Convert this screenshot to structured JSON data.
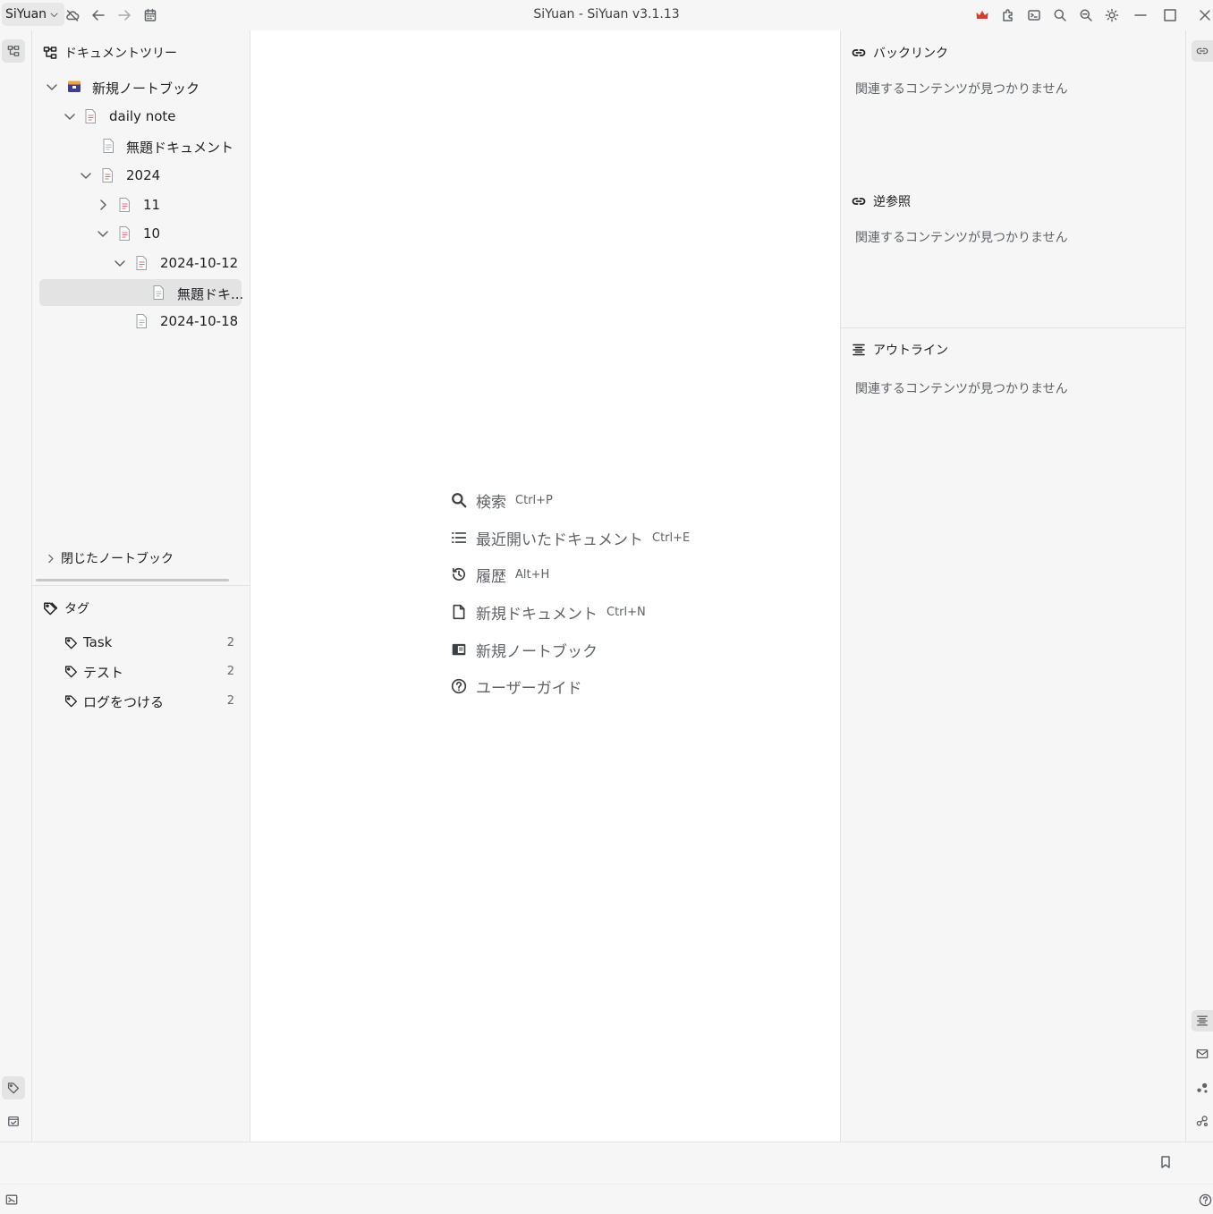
{
  "window": {
    "title": "SiYuan - SiYuan v3.1.13",
    "workspace_label": "SiYuan"
  },
  "toolbar": {
    "left_icons": [
      "sync-cloud-icon",
      "back-arrow-icon",
      "forward-arrow-icon",
      "calendar-icon"
    ],
    "right_icons": [
      "crown-icon",
      "plugin-icon",
      "command-icon",
      "search-icon",
      "zoom-icon",
      "theme-sun-icon",
      "minimize-icon",
      "maximize-icon",
      "close-icon"
    ],
    "accent_color": "#d23f31"
  },
  "left_dock": {
    "icons": [
      "file-tree-icon",
      "tag-icon",
      "calendar-check-icon"
    ]
  },
  "file_tree": {
    "title": "ドキュメントツリー",
    "items": [
      {
        "label": "新規ノートブック",
        "kind": "notebook",
        "expanded": true
      },
      {
        "label": "daily note",
        "kind": "doc",
        "expanded": true
      },
      {
        "label": "無題ドキュメント",
        "kind": "doc"
      },
      {
        "label": "2024",
        "kind": "doc",
        "expanded": true
      },
      {
        "label": "11",
        "kind": "doc",
        "expanded": false
      },
      {
        "label": "10",
        "kind": "doc",
        "expanded": true
      },
      {
        "label": "2024-10-12",
        "kind": "doc",
        "expanded": true
      },
      {
        "label": "無題ドキ...",
        "kind": "doc",
        "selected": true
      },
      {
        "label": "2024-10-18",
        "kind": "doc"
      }
    ],
    "closed_notebooks_label": "閉じたノートブック"
  },
  "tags": {
    "title": "タグ",
    "items": [
      {
        "label": "Task",
        "count": "2"
      },
      {
        "label": "テスト",
        "count": "2"
      },
      {
        "label": "ログをつける",
        "count": "2"
      }
    ]
  },
  "empty_editor": {
    "items": [
      {
        "label": "検索",
        "shortcut": "Ctrl+P",
        "icon": "search-icon"
      },
      {
        "label": "最近開いたドキュメント",
        "shortcut": "Ctrl+E",
        "icon": "list-icon"
      },
      {
        "label": "履歴",
        "shortcut": "Alt+H",
        "icon": "history-icon"
      },
      {
        "label": "新規ドキュメント",
        "shortcut": "Ctrl+N",
        "icon": "new-doc-icon"
      },
      {
        "label": "新規ノートブック",
        "shortcut": "",
        "icon": "notebook-icon"
      },
      {
        "label": "ユーザーガイド",
        "shortcut": "",
        "icon": "help-icon"
      }
    ]
  },
  "right_panel": {
    "backlinks": {
      "title": "バックリンク",
      "empty": "関連するコンテンツが見つかりません"
    },
    "backmentions": {
      "title": "逆参照",
      "empty": "関連するコンテンツが見つかりません"
    },
    "outline": {
      "title": "アウトライン",
      "empty": "関連するコンテンツが見つかりません"
    }
  },
  "right_dock": {
    "icons": [
      "backlink-icon",
      "outline-icon",
      "inbox-icon",
      "graph-icon",
      "global-graph-icon"
    ]
  },
  "bottom": {
    "icons": [
      "bookmark-icon",
      "fullscreen-icon",
      "help-icon"
    ]
  }
}
